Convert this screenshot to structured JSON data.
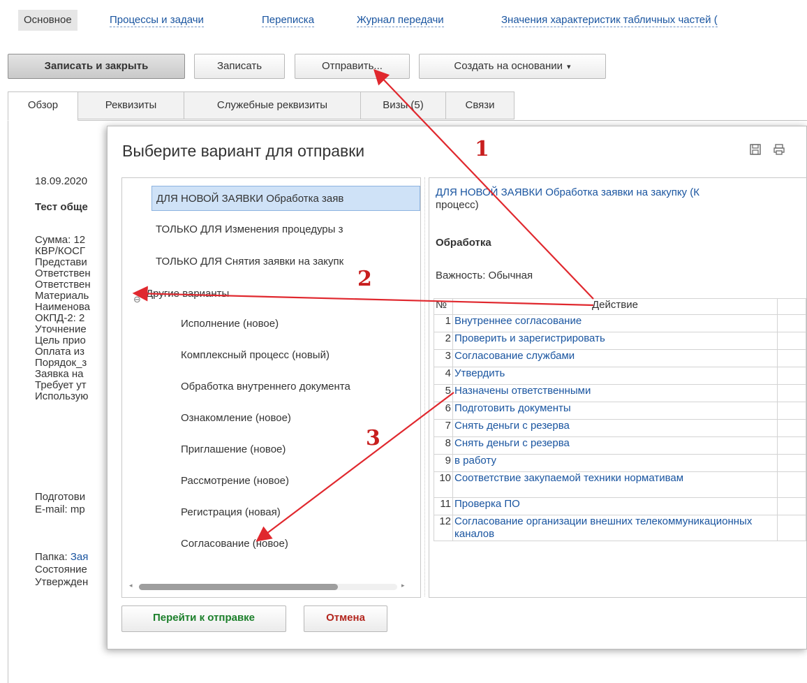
{
  "topnav": {
    "items": [
      "Основное",
      "Процессы и задачи",
      "Переписка",
      "Журнал передачи",
      "Значения характеристик табличных частей ("
    ]
  },
  "toolbar": {
    "save_close": "Записать и закрыть",
    "save": "Записать",
    "send": "Отправить...",
    "create_based": "Создать на основании"
  },
  "tabs": [
    "Обзор",
    "Реквизиты",
    "Служебные реквизиты",
    "Визы (5)",
    "Связи"
  ],
  "background_doc": {
    "date": "18.09.2020",
    "title": "Тест обще",
    "lines": [
      "Сумма: 12",
      "КВР/КОСГ",
      "Представи",
      "Ответствен",
      "Ответствен",
      "Материаль",
      "Наименова",
      "ОКПД-2: 2",
      "Уточнение",
      "Цель прио",
      "Оплата из",
      "Порядок_з",
      "Заявка на",
      "Требует ут",
      "Использую"
    ],
    "prepared": "Подготови",
    "email": "E-mail: mp",
    "folder_label": "Папка:",
    "folder_link": "Зая",
    "state": "Состояние",
    "approved": "Утвержден"
  },
  "dialog": {
    "title": "Выберите вариант для отправки",
    "tree": [
      "ДЛЯ НОВОЙ ЗАЯВКИ Обработка заяв",
      "ТОЛЬКО ДЛЯ Изменения процедуры з",
      "ТОЛЬКО ДЛЯ Снятия заявки на закупк",
      "Другие варианты",
      "Исполнение (новое)",
      "Комплексный процесс (новый)",
      "Обработка внутреннего документа",
      "Ознакомление (новое)",
      "Приглашение (новое)",
      "Рассмотрение (новое)",
      "Регистрация (новая)",
      "Согласование (новое)"
    ],
    "details": {
      "link_line1": "ДЛЯ НОВОЙ ЗАЯВКИ Обработка заявки на закупку (К",
      "link_line2": "процесс)",
      "section": "Обработка",
      "importance": "Важность: Обычная",
      "col_num": "№",
      "col_action": "Действие",
      "actions": [
        {
          "n": "1",
          "a": "Внутреннее согласование"
        },
        {
          "n": "2",
          "a": "Проверить и зарегистрировать"
        },
        {
          "n": "3",
          "a": "Согласование службами"
        },
        {
          "n": "4",
          "a": "Утвердить"
        },
        {
          "n": "5",
          "a": "Назначены ответственными"
        },
        {
          "n": "6",
          "a": "Подготовить документы"
        },
        {
          "n": "7",
          "a": "Снять деньги с резерва"
        },
        {
          "n": "8",
          "a": "Снять деньги с резерва"
        },
        {
          "n": "9",
          "a": "в работу"
        },
        {
          "n": "10",
          "a": "Соответствие закупаемой техники нормативам"
        },
        {
          "n": "11",
          "a": "Проверка ПО"
        },
        {
          "n": "12",
          "a": "Согласование организации внешних телекоммуникационных каналов"
        }
      ]
    },
    "go_button": "Перейти к отправке",
    "cancel_button": "Отмена"
  },
  "annotations": [
    "1",
    "2",
    "3"
  ],
  "colors": {
    "annotation": "#e0282e",
    "link": "#1a55a0"
  }
}
